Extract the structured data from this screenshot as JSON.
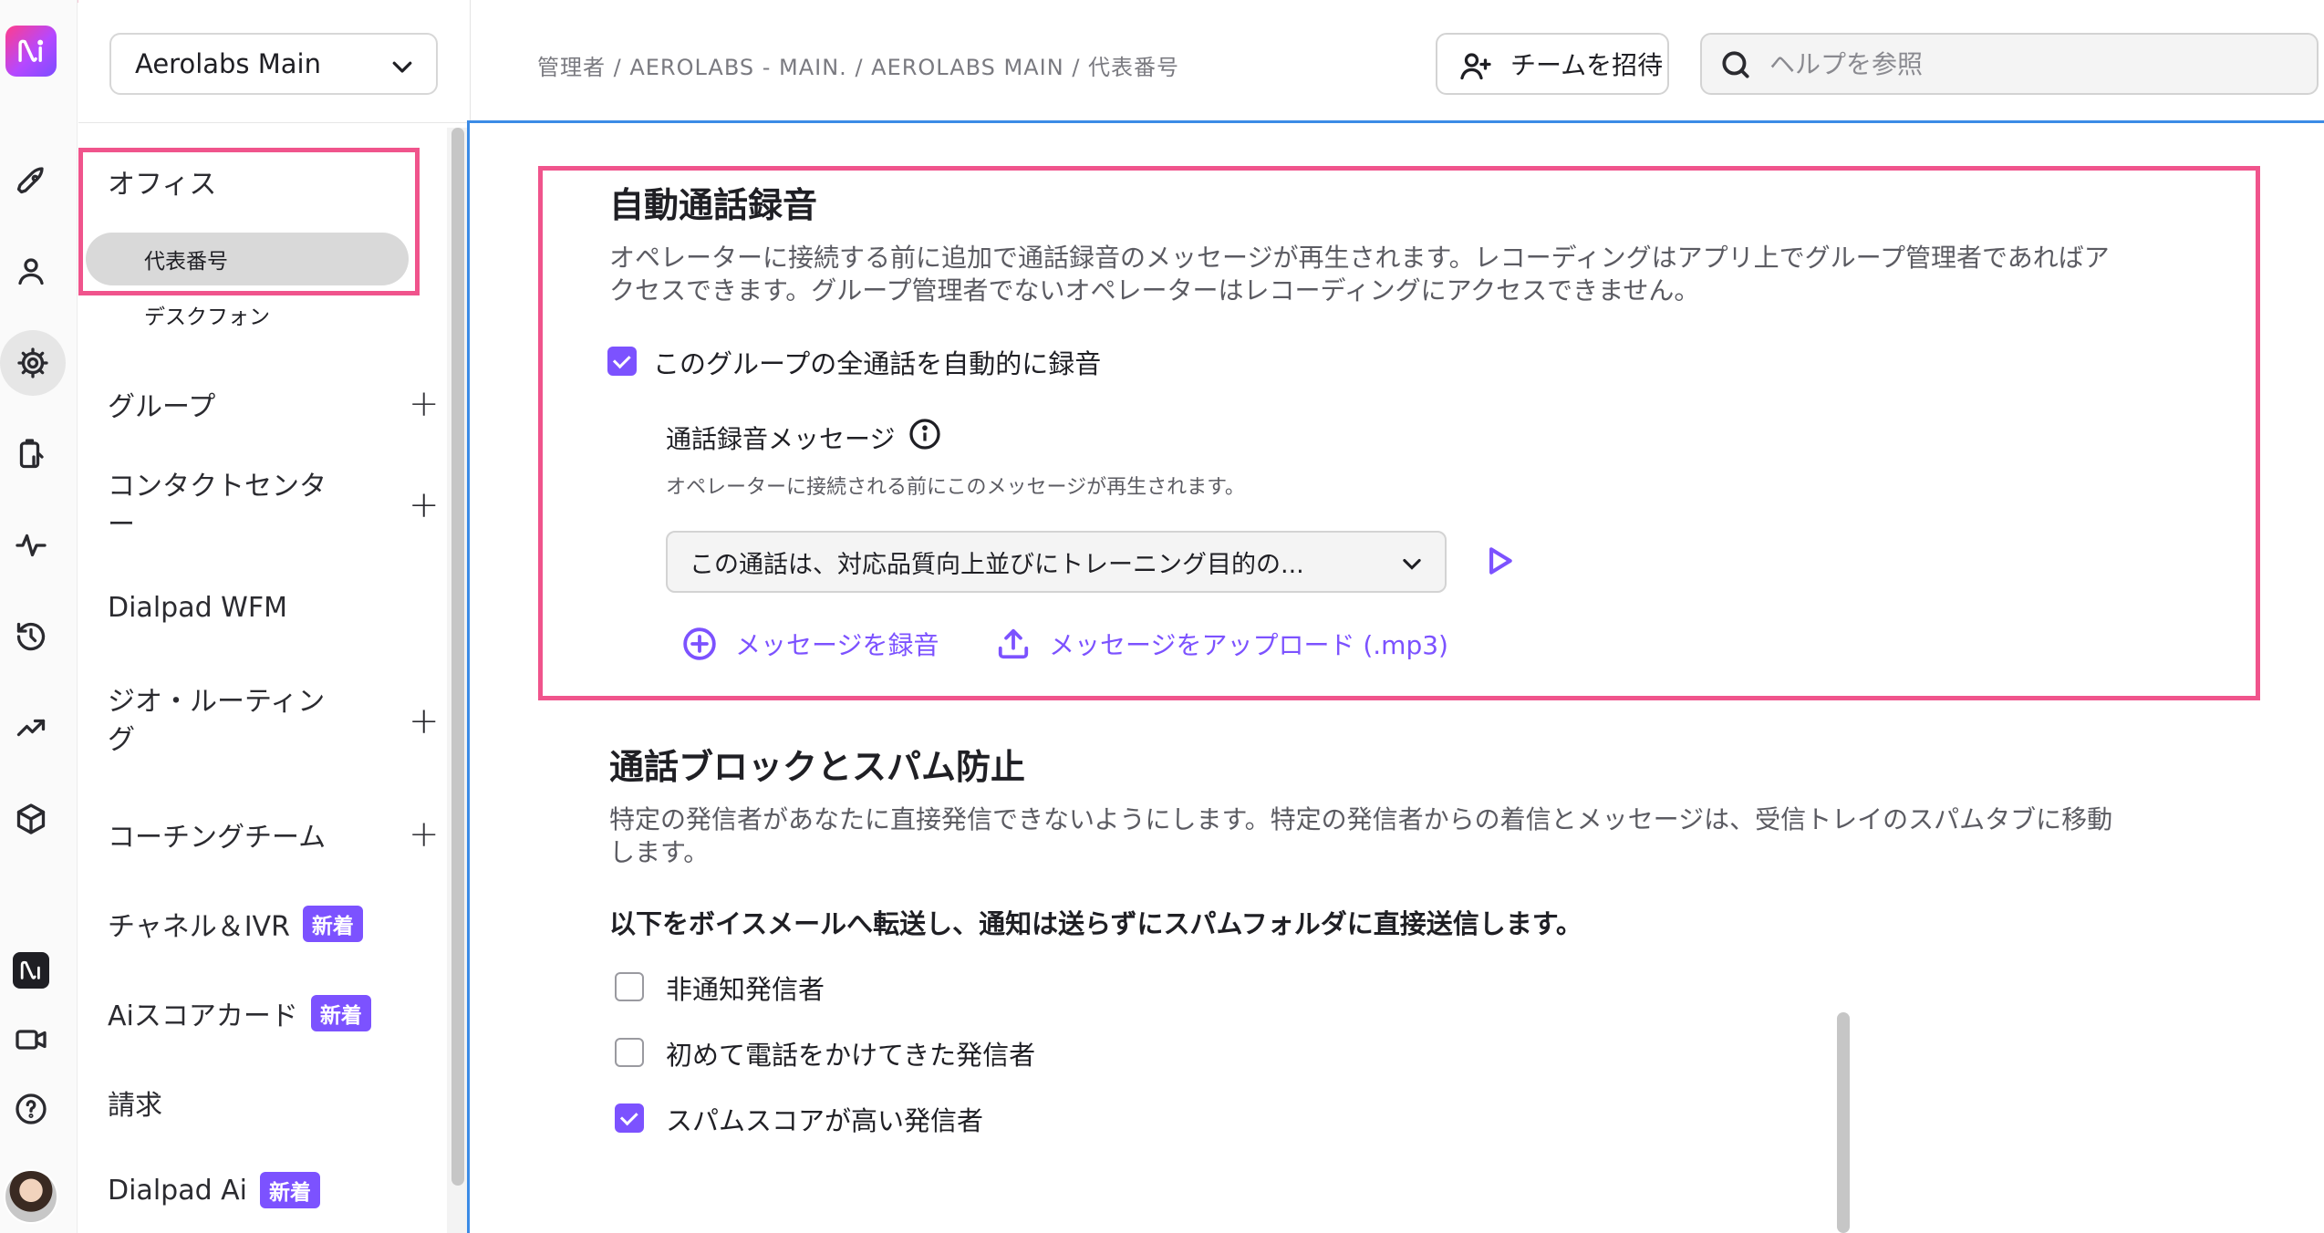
{
  "header": {
    "breadcrumb": "管理者 / AEROLABS - MAIN. / AEROLABS MAIN / 代表番号",
    "invite_label": "チームを招待",
    "search_placeholder": "ヘルプを参照"
  },
  "sidebar": {
    "org_name": "Aerolabs Main",
    "items": {
      "office": "オフィス",
      "office_main": "代表番号",
      "office_desk": "デスクフォン",
      "groups": "グループ",
      "contact_center_1": "コンタクトセンタ",
      "contact_center_2": "ー",
      "wfm": "Dialpad WFM",
      "geo_1": "ジオ・ルーティン",
      "geo_2": "グ",
      "coaching": "コーチングチーム",
      "channel": "チャネル＆IVR",
      "scorecard": "Aiスコアカード",
      "billing": "請求",
      "dialpad_ai": "Dialpad Ai"
    },
    "new_badge": "新着",
    "plus": "+"
  },
  "recording": {
    "title": "自動通話録音",
    "desc_1": "オペレーターに接続する前に追加で通話録音のメッセージが再生されます。レコーディングはアプリ上でグループ管理者であればア",
    "desc_2": "クセスできます。グループ管理者でないオペレーターはレコーディングにアクセスできません。",
    "auto_record_label": "このグループの全通話を自動的に録音",
    "auto_record_checked": true,
    "message_label": "通話録音メッセージ",
    "message_desc": "オペレーターに接続される前にこのメッセージが再生されます。",
    "message_value": "この通話は、対応品質向上並びにトレーニング目的の...",
    "record_link": "メッセージを録音",
    "upload_link": "メッセージをアップロード (.mp3)"
  },
  "spam": {
    "title": "通話ブロックとスパム防止",
    "desc_1": "特定の発信者があなたに直接発信できないようにします。特定の発信者からの着信とメッセージは、受信トレイのスパムタブに移動",
    "desc_2": "します。",
    "forward_heading": "以下をボイスメールへ転送し、通知は送らずにスパムフォルダに直接送信します。",
    "options": [
      {
        "label": "非通知発信者",
        "checked": false
      },
      {
        "label": "初めて電話をかけてきた発信者",
        "checked": false
      },
      {
        "label": "スパムスコアが高い発信者",
        "checked": true
      }
    ]
  },
  "colors": {
    "accent": "#7c52ff",
    "highlight": "#f0548c",
    "focus": "#3b8be6"
  }
}
